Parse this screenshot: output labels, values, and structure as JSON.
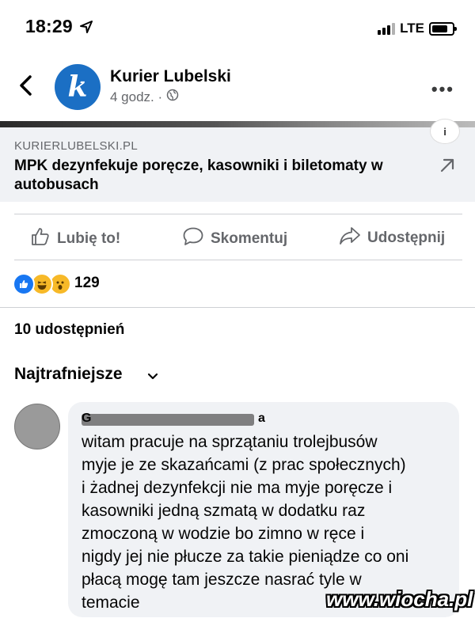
{
  "status_bar": {
    "time": "18:29",
    "network": "LTE"
  },
  "post": {
    "page_name": "Kurier Lubelski",
    "avatar_letter": "k",
    "meta_time": "4 godz. ·",
    "brand_color": "#1b6fc4"
  },
  "link_preview": {
    "domain": "KURIERLUBELSKI.PL",
    "title": "MPK dezynfekuje poręcze, kasowniki i biletomaty w autobusach",
    "info_badge": "i"
  },
  "actions": {
    "like": "Lubię to!",
    "comment": "Skomentuj",
    "share": "Udostępnij"
  },
  "reactions": {
    "count": "129",
    "types": [
      "like-icon",
      "haha-icon",
      "wow-icon"
    ]
  },
  "shares": "10 udostępnień",
  "sort": {
    "label": "Najtrafniejsze"
  },
  "comment": {
    "author_first": "G",
    "author_last": "a",
    "text": "witam pracuje na sprzątaniu trolejbusów\nmyje je ze skazańcami (z prac społecznych)\ni żadnej dezynfekcji nie ma myje poręcze i\nkasowniki jedną szmatą w dodatku raz\nzmoczoną w wodzie bo zimno w ręce i\nnigdy jej nie płucze za takie pieniądze co oni\npłacą mogę tam jeszcze nasrać tyle w\ntemacie"
  },
  "watermark": "www.wiocha.pl"
}
